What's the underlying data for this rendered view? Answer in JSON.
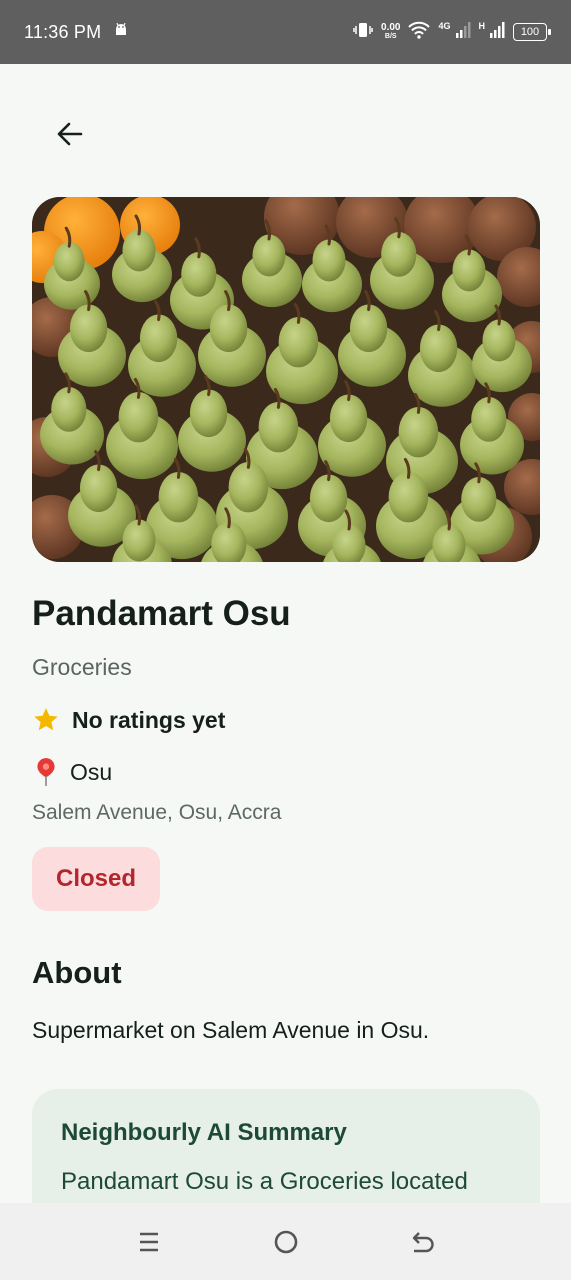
{
  "status_bar": {
    "time": "11:36 PM",
    "net_speed_value": "0.00",
    "net_speed_unit": "B/S",
    "network_type_1": "4G",
    "network_type_2": "H",
    "battery": "100"
  },
  "store": {
    "name": "Pandamart Osu",
    "category": "Groceries",
    "rating": "No ratings yet",
    "area": "Osu",
    "address": "Salem Avenue, Osu, Accra",
    "status": "Closed"
  },
  "about": {
    "heading": "About",
    "text": "Supermarket on Salem Avenue in Osu."
  },
  "ai_summary": {
    "title": "Neighbourly AI Summary",
    "text": "Pandamart Osu is a Groceries located"
  },
  "colors": {
    "closed_bg": "#fcdcdc",
    "closed_text": "#b3262d",
    "ai_card_bg": "#e6efe8",
    "ai_text": "#1d4a36",
    "star": "#f5b800",
    "pin": "#e53935"
  },
  "icons": [
    "back-arrow-icon",
    "star-icon",
    "location-pin-icon",
    "menu-icon",
    "home-icon",
    "back-nav-icon"
  ]
}
